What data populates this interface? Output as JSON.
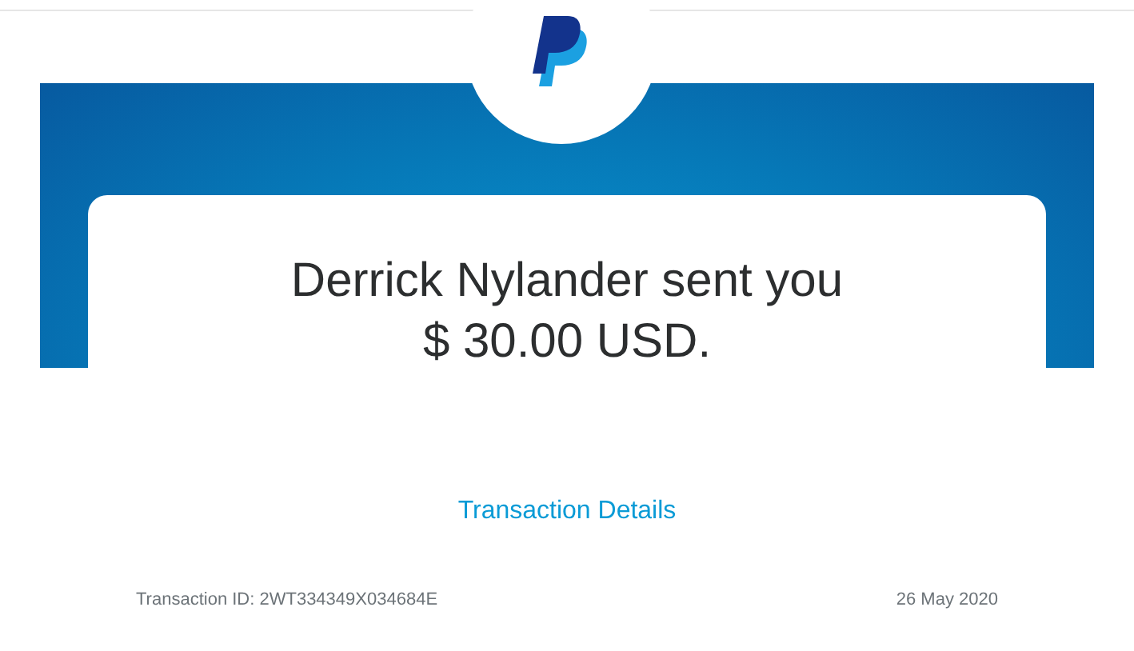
{
  "heading": {
    "line_1": "Derrick Nylander sent you",
    "line_2": "$ 30.00 USD."
  },
  "link": "Transaction Details",
  "footer": {
    "transaction_id": "Transaction ID: 2WT334349X034684E",
    "date": "26 May 2020"
  }
}
